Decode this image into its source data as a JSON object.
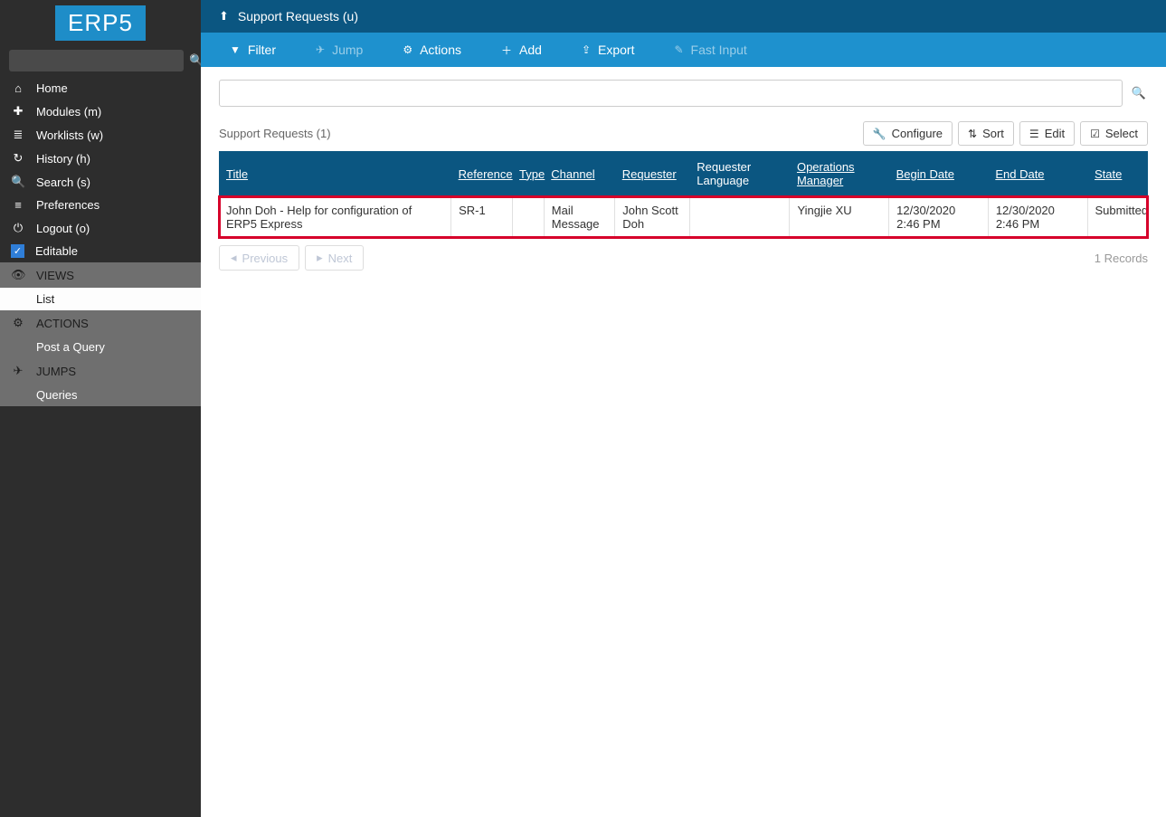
{
  "logo": "ERP5",
  "sidebar": {
    "nav": [
      {
        "icon": "⌂",
        "label": "Home"
      },
      {
        "icon": "✚",
        "label": "Modules (m)"
      },
      {
        "icon": "≣",
        "label": "Worklists (w)"
      },
      {
        "icon": "↻",
        "label": "History (h)"
      },
      {
        "icon": "🔍",
        "label": "Search (s)"
      },
      {
        "icon": "≡",
        "label": "Preferences"
      },
      {
        "icon": "⏻",
        "label": "Logout (o)"
      }
    ],
    "editable_label": "Editable",
    "views_header": "VIEWS",
    "views_items": [
      "List"
    ],
    "actions_header": "ACTIONS",
    "actions_items": [
      "Post a Query"
    ],
    "jumps_header": "JUMPS",
    "jumps_items": [
      "Queries"
    ]
  },
  "topbar": {
    "title": "Support Requests (u)"
  },
  "toolbar": {
    "filter": "Filter",
    "jump": "Jump",
    "actions": "Actions",
    "add": "Add",
    "export": "Export",
    "fast_input": "Fast Input"
  },
  "listing": {
    "title": "Support Requests (1)",
    "buttons": {
      "configure": "Configure",
      "sort": "Sort",
      "edit": "Edit",
      "select": "Select"
    },
    "columns": {
      "title": "Title",
      "reference": "Reference",
      "type": "Type",
      "channel": "Channel",
      "requester": "Requester",
      "requester_language": "Requester Language",
      "operations_manager": "Operations Manager",
      "begin_date": "Begin Date",
      "end_date": "End Date",
      "state": "State"
    },
    "rows": [
      {
        "title": "John Doh - Help for configuration of ERP5 Express",
        "reference": "SR-1",
        "type": "",
        "channel": "Mail Message",
        "requester": "John Scott Doh",
        "requester_language": "",
        "operations_manager": "Yingjie XU",
        "begin_date": "12/30/2020 2:46 PM",
        "end_date": "12/30/2020 2:46 PM",
        "state": "Submitted"
      }
    ],
    "pager": {
      "previous": "Previous",
      "next": "Next",
      "records": "1 Records"
    }
  }
}
